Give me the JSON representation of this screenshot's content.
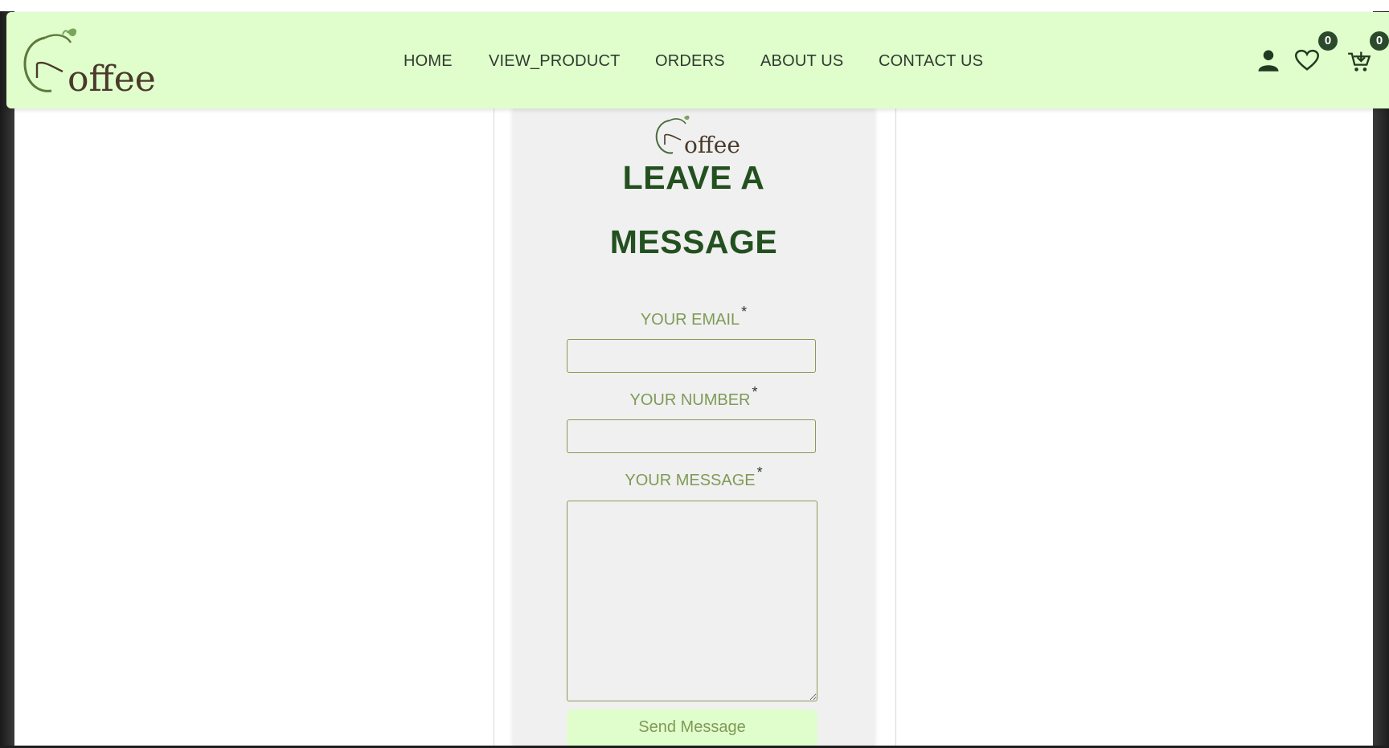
{
  "brand": {
    "logo_text": "offee"
  },
  "nav": {
    "links": [
      "HOME",
      "VIEW_PRODUCT",
      "ORDERS",
      "ABOUT US",
      "CONTACT US"
    ],
    "wishlist_count": "0",
    "cart_count": "0",
    "icons": [
      "user-icon",
      "heart-icon",
      "cart-icon"
    ]
  },
  "form": {
    "heading_line1": "LEAVE A",
    "heading_line2": "MESSAGE",
    "email_label": "YOUR EMAIL",
    "number_label": "YOUR NUMBER",
    "message_label": "YOUR MESSAGE",
    "required_mark": "*",
    "email_value": "",
    "number_value": "",
    "message_value": "",
    "submit_label": "Send Message"
  },
  "colors": {
    "navbar_bg": "#e0fdcc",
    "heading": "#23501f",
    "label": "#7f9a57",
    "badge": "#2b4a2b"
  }
}
